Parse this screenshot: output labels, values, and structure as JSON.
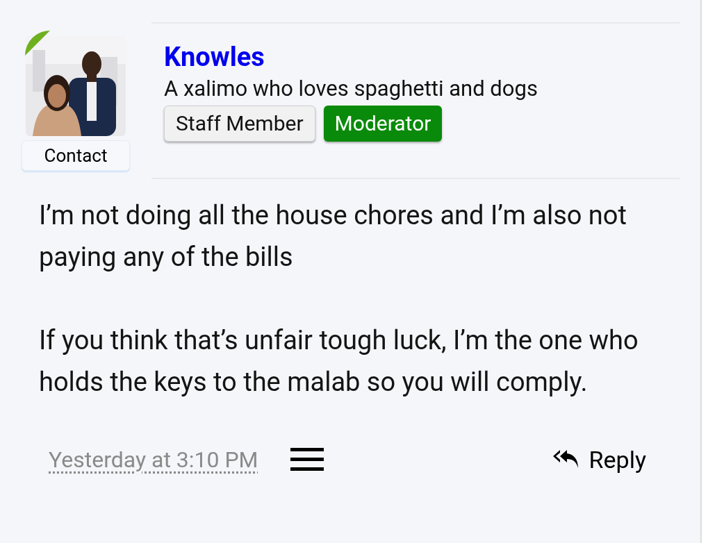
{
  "author": {
    "name": "Knowles",
    "online": true,
    "tagline": "A xalimo who loves spaghetti and dogs",
    "contact_label": "Contact"
  },
  "badges": [
    {
      "label": "Staff Member",
      "kind": "staff"
    },
    {
      "label": "Moderator",
      "kind": "moderator"
    }
  ],
  "paragraphs": [
    "I’m not doing all the house chores and I’m also not paying any of the bills",
    "If you think that’s unfair tough luck, I’m the one who holds the keys to the malab so you will comply."
  ],
  "footer": {
    "time": "Yesterday at 3:10 PM",
    "reply_label": "Reply"
  }
}
